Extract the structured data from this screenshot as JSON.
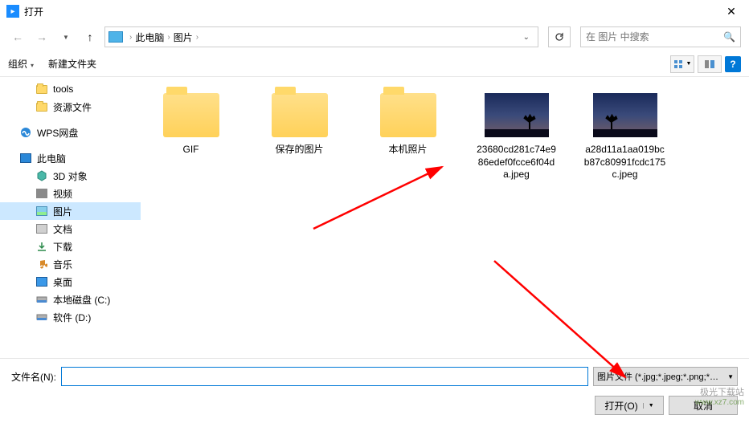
{
  "title": "打开",
  "breadcrumb": {
    "root": "此电脑",
    "current": "图片"
  },
  "search": {
    "placeholder": "在 图片 中搜索"
  },
  "toolbar": {
    "organize": "组织",
    "newfolder": "新建文件夹"
  },
  "sidebar": {
    "items": [
      {
        "label": "tools",
        "icon": "folder",
        "level": 2,
        "selected": false
      },
      {
        "label": "资源文件",
        "icon": "folder",
        "level": 2,
        "selected": false
      },
      {
        "label": "WPS网盘",
        "icon": "wps",
        "level": 1,
        "selected": false,
        "gap": true
      },
      {
        "label": "此电脑",
        "icon": "pc",
        "level": 1,
        "selected": false,
        "gap": true
      },
      {
        "label": "3D 对象",
        "icon": "lib-3d",
        "level": 2,
        "selected": false
      },
      {
        "label": "视频",
        "icon": "lib-video",
        "level": 2,
        "selected": false
      },
      {
        "label": "图片",
        "icon": "pic",
        "level": 2,
        "selected": true
      },
      {
        "label": "文档",
        "icon": "lib-doc",
        "level": 2,
        "selected": false
      },
      {
        "label": "下载",
        "icon": "lib-dl",
        "level": 2,
        "selected": false
      },
      {
        "label": "音乐",
        "icon": "lib-music",
        "level": 2,
        "selected": false
      },
      {
        "label": "桌面",
        "icon": "lib-desktop",
        "level": 2,
        "selected": false
      },
      {
        "label": "本地磁盘 (C:)",
        "icon": "drive",
        "level": 2,
        "selected": false
      },
      {
        "label": "软件 (D:)",
        "icon": "drive",
        "level": 2,
        "selected": false
      }
    ]
  },
  "files": [
    {
      "label": "GIF",
      "type": "folder"
    },
    {
      "label": "保存的图片",
      "type": "folder"
    },
    {
      "label": "本机照片",
      "type": "folder"
    },
    {
      "label": "23680cd281c74e986edef0fcce6f04da.jpeg",
      "type": "image",
      "treeLeft": "55px"
    },
    {
      "label": "a28d11a1aa019bcb87c80991fcdc175c.jpeg",
      "type": "image",
      "treeLeft": "22px"
    }
  ],
  "filename": {
    "label": "文件名(N):",
    "value": ""
  },
  "filetype": "图片文件 (*.jpg;*.jpeg;*.png;*…",
  "buttons": {
    "open": "打开(O)",
    "cancel": "取消"
  },
  "watermark": {
    "line1": "极光下载站",
    "line2": "www.xz7.com"
  }
}
